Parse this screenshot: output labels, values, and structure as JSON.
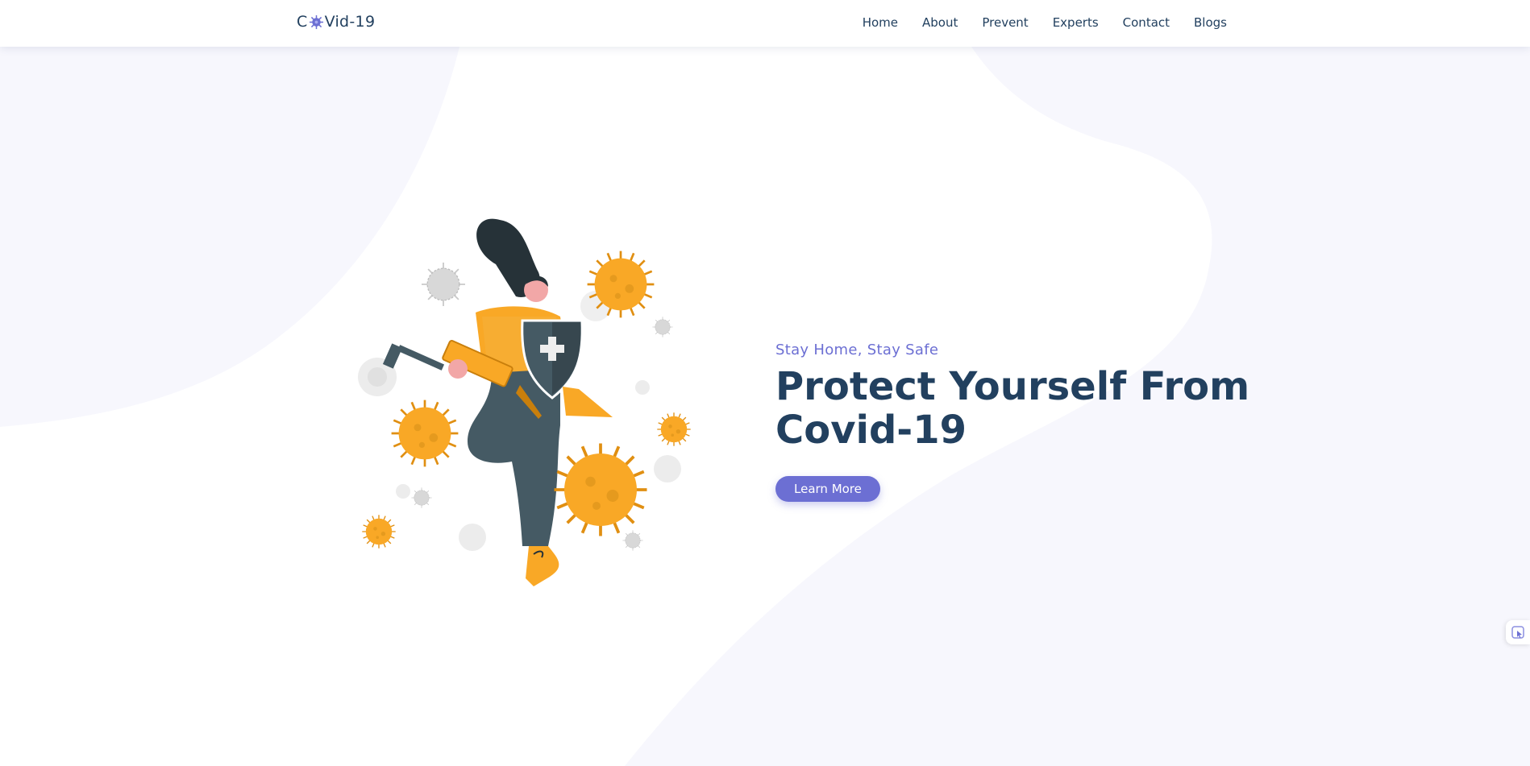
{
  "brand": {
    "name_prefix": "C",
    "name_suffix": "Vid-19",
    "logo_icon": "virus-icon"
  },
  "nav": {
    "items": [
      {
        "label": "Home"
      },
      {
        "label": "About"
      },
      {
        "label": "Prevent"
      },
      {
        "label": "Experts"
      },
      {
        "label": "Contact"
      },
      {
        "label": "Blogs"
      }
    ]
  },
  "hero": {
    "subtitle": "Stay Home, Stay Safe",
    "title_line1": "Protect Yourself From",
    "title_line2": "Covid-19",
    "cta_label": "Learn More"
  },
  "side_widget": {
    "icon": "cursor-pointer-icon"
  },
  "colors": {
    "accent": "#6c6fd3",
    "heading": "#22405f",
    "blob": "#f7f7fd",
    "virus": "#f9a826"
  }
}
